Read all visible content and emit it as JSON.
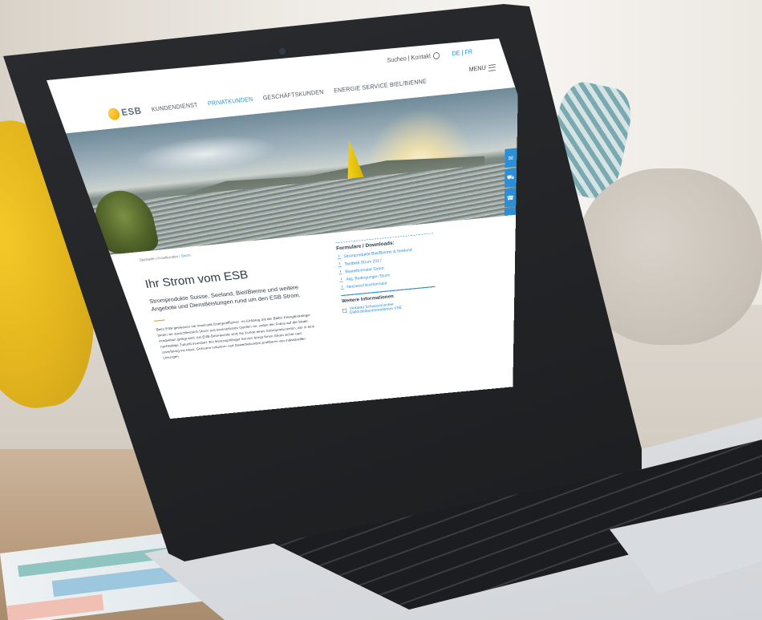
{
  "header": {
    "utility_left": "Sucheo | Kontakt",
    "utility_lang": "DE | FR",
    "menu_label": "MENU",
    "logo_text": "ESB",
    "nav": [
      {
        "label": "KUNDENDIENST",
        "active": false
      },
      {
        "label": "PRIVATKUNDEN",
        "active": true
      },
      {
        "label": "GESCHÄFTSKUNDEN",
        "active": false
      },
      {
        "label": "ENERGIE SERVICE BIEL/BIENNE",
        "active": false
      }
    ]
  },
  "side_tools": [
    "✉",
    "⛟",
    "☎",
    "✎",
    "?"
  ],
  "breadcrumb": {
    "prefix": "Startseite / Privatkunden /",
    "current": "Strom"
  },
  "main": {
    "title": "Ihr Strom vom ESB",
    "lead": "Stromprodukte Suisse, Seeland, Biel/Bienne und weitere Angebote und Dienstleistungen rund um den ESB Strom.",
    "body": "Beim ESB geniessen sie maximale Energieeffizienz. Im Einklang mit der Bieler Energiestrategie bieten wir ausschliesslich Strom aus erneuerbaren Quellen an, wobei der Fokus auf die lokale Produktion gelegt wird. Als ESB-Stromkunde sind Sie Kunde eines Stromproduzenten, der in eine nachhaltige Zukunft investiert. Ein leistungsfähiger Service bringt Ihnen Strom sicher und zuverlässig ins Haus. Grössere Industrie- und Gewerbekunden profitieren von individuellen Lösungen."
  },
  "aside": {
    "downloads_title": "Formulare / Downloads:",
    "downloads": [
      "Stromprodukte Biel/Bienne & Seeland",
      "Tarifblatt Strom 2017",
      "Bestellformular Strom",
      "Allg. Bedingungen Strom",
      "Netzanschlussformular"
    ],
    "more_title": "Weitere Informationen",
    "more_links": [
      "Verband Schweizerischer Elektrizitätsunternehmen VSE"
    ]
  },
  "colors": {
    "accent": "#2a8fd6",
    "brand_yellow": "#f0a400",
    "text": "#2d3b48"
  }
}
